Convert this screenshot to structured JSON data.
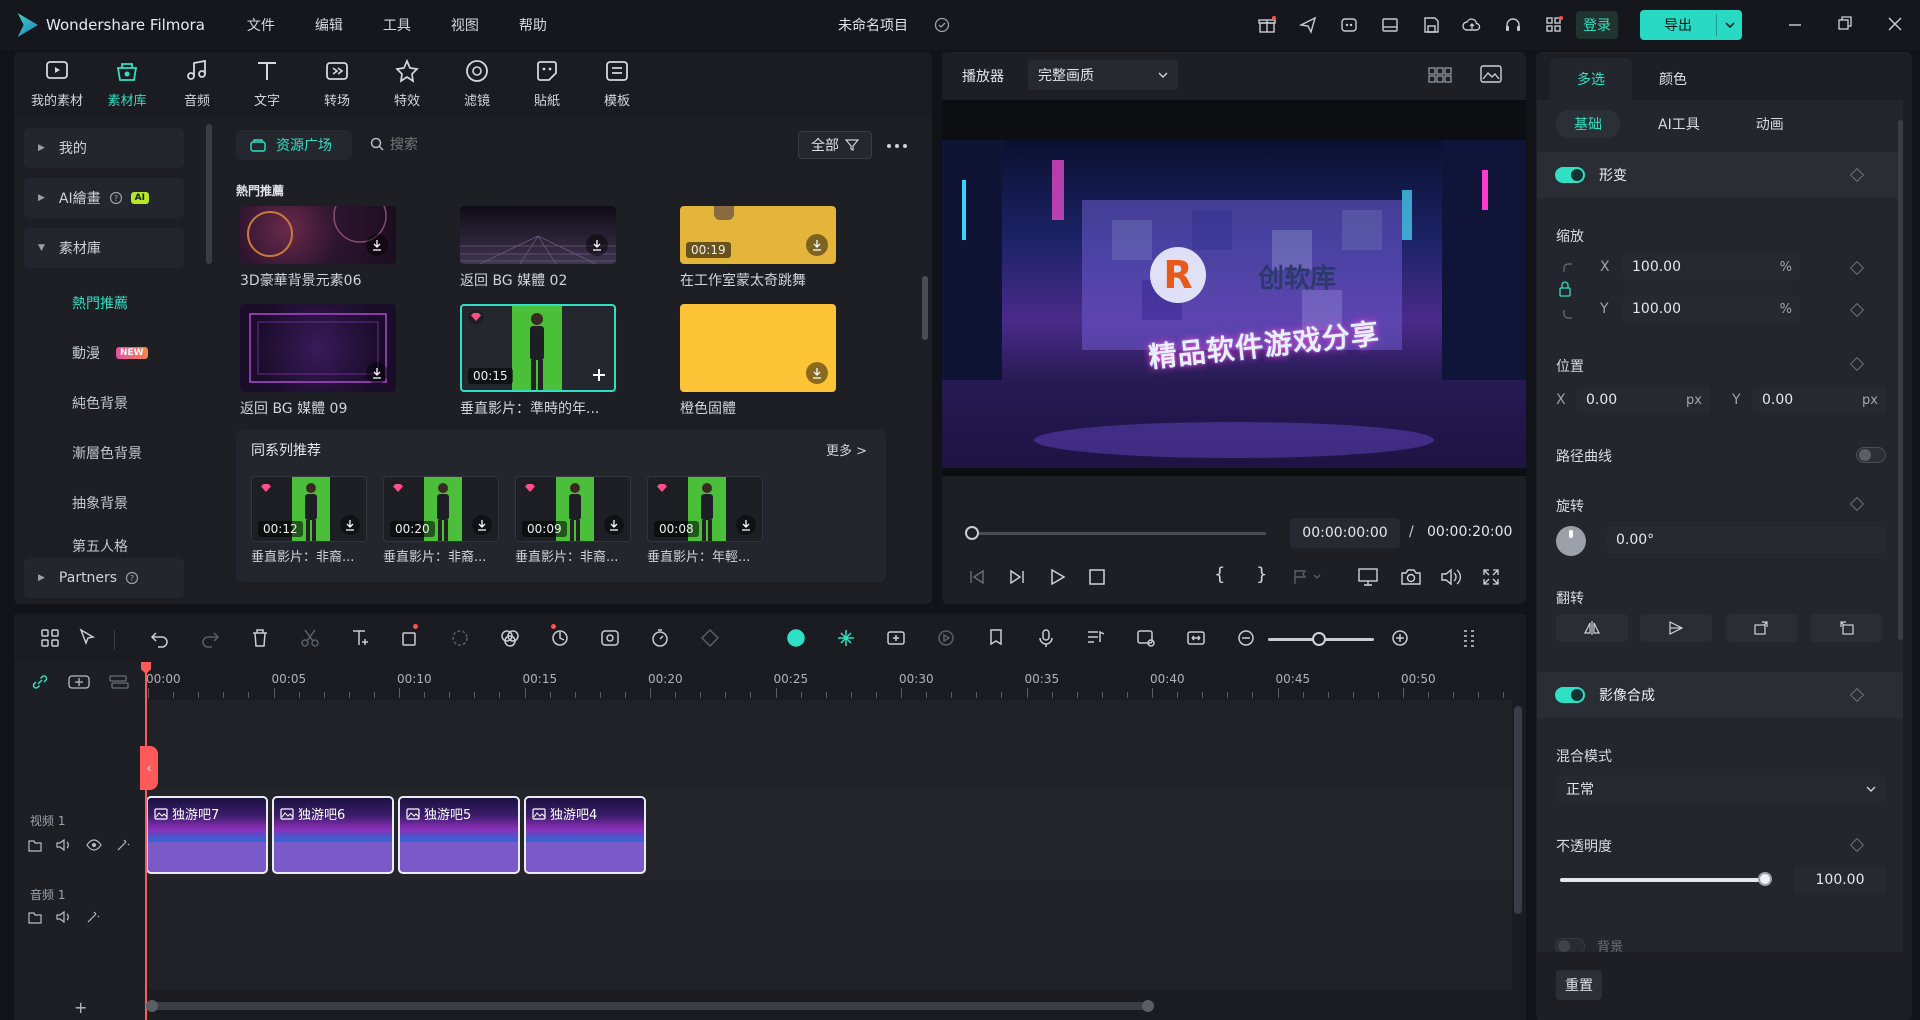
{
  "app": {
    "name": "Wondershare Filmora",
    "project_title": "未命名项目"
  },
  "menu": [
    "文件",
    "编辑",
    "工具",
    "视图",
    "帮助"
  ],
  "header": {
    "login_label": "登录",
    "export_label": "导出"
  },
  "tool_tabs": [
    {
      "label": "我的素材",
      "icon": "media-icon"
    },
    {
      "label": "素材库",
      "icon": "stock-icon",
      "active": true
    },
    {
      "label": "音频",
      "icon": "audio-icon"
    },
    {
      "label": "文字",
      "icon": "text-icon"
    },
    {
      "label": "转场",
      "icon": "transition-icon"
    },
    {
      "label": "特效",
      "icon": "effects-icon"
    },
    {
      "label": "滤镜",
      "icon": "filter-icon"
    },
    {
      "label": "貼紙",
      "icon": "sticker-icon"
    },
    {
      "label": "模板",
      "icon": "template-icon"
    }
  ],
  "sidebar": {
    "groups": [
      {
        "label": "我的"
      },
      {
        "label": "AI繪畫",
        "badge": "AI"
      },
      {
        "label": "素材庫"
      }
    ],
    "sub_items": [
      {
        "label": "熱門推薦",
        "active": true
      },
      {
        "label": "動漫",
        "badge": "NEW"
      },
      {
        "label": "純色背景"
      },
      {
        "label": "漸層色背景"
      },
      {
        "label": "抽象背景"
      },
      {
        "label": "第五人格"
      }
    ],
    "partners": "Partners"
  },
  "library": {
    "source_button": "资源广场",
    "search_placeholder": "搜索",
    "filter_label": "全部",
    "section_title": "熱門推薦",
    "row1": [
      {
        "caption": "3D豪華背景元素06"
      },
      {
        "caption": "返回 BG 媒體 02"
      },
      {
        "caption": "在工作室蒙太奇跳舞",
        "duration": "00:19"
      }
    ],
    "row2": [
      {
        "caption": "返回 BG 媒體 09"
      },
      {
        "caption": "垂直影片：準時的年...",
        "duration": "00:15"
      },
      {
        "caption": "橙色固體"
      }
    ],
    "series": {
      "title": "同系列推荐",
      "more": "更多 >",
      "items": [
        {
          "caption": "垂直影片：非裔...",
          "duration": "00:12"
        },
        {
          "caption": "垂直影片：非裔...",
          "duration": "00:20"
        },
        {
          "caption": "垂直影片：非裔...",
          "duration": "00:09"
        },
        {
          "caption": "垂直影片：年輕...",
          "duration": "00:08"
        }
      ]
    }
  },
  "player": {
    "label": "播放器",
    "quality": "完整画质",
    "preview_brand": "创软库",
    "preview_slogan": "精品软件游戏分享",
    "current_time": "00:00:00:00",
    "separator": "/",
    "total_time": "00:00:20:00"
  },
  "properties": {
    "tabs": [
      "多选",
      "颜色"
    ],
    "subtabs": [
      "基础",
      "AI工具",
      "动画"
    ],
    "transform": {
      "title": "形变",
      "scale_label": "缩放",
      "scale_x_axis": "X",
      "scale_x": "100.00",
      "scale_y_axis": "Y",
      "scale_y": "100.00",
      "percent": "%",
      "position_label": "位置",
      "pos_x_axis": "X",
      "pos_x": "0.00",
      "pos_y_axis": "Y",
      "pos_y": "0.00",
      "px": "px",
      "path_curve": "路径曲线",
      "rotate_label": "旋转",
      "rotate_value": "0.00°",
      "flip_label": "翻转"
    },
    "composite": {
      "title": "影像合成",
      "blend_label": "混合模式",
      "blend_value": "正常",
      "opacity_label": "不透明度",
      "opacity_value": "100.00",
      "background_label": "背景"
    },
    "reset": "重置"
  },
  "timeline": {
    "ticks": [
      "00:00",
      "00:05",
      "00:10",
      "00:15",
      "00:20",
      "00:25",
      "00:30",
      "00:35",
      "00:40",
      "00:45",
      "00:50"
    ],
    "video_track": "视频 1",
    "audio_track": "音频 1",
    "clips": [
      "独游吧7",
      "独游吧6",
      "独游吧5",
      "独游吧4"
    ],
    "add_track": "+"
  },
  "colors": {
    "accent": "#2fe0c4",
    "clip": "#7a5ac8",
    "playhead": "#ff5a5a"
  }
}
